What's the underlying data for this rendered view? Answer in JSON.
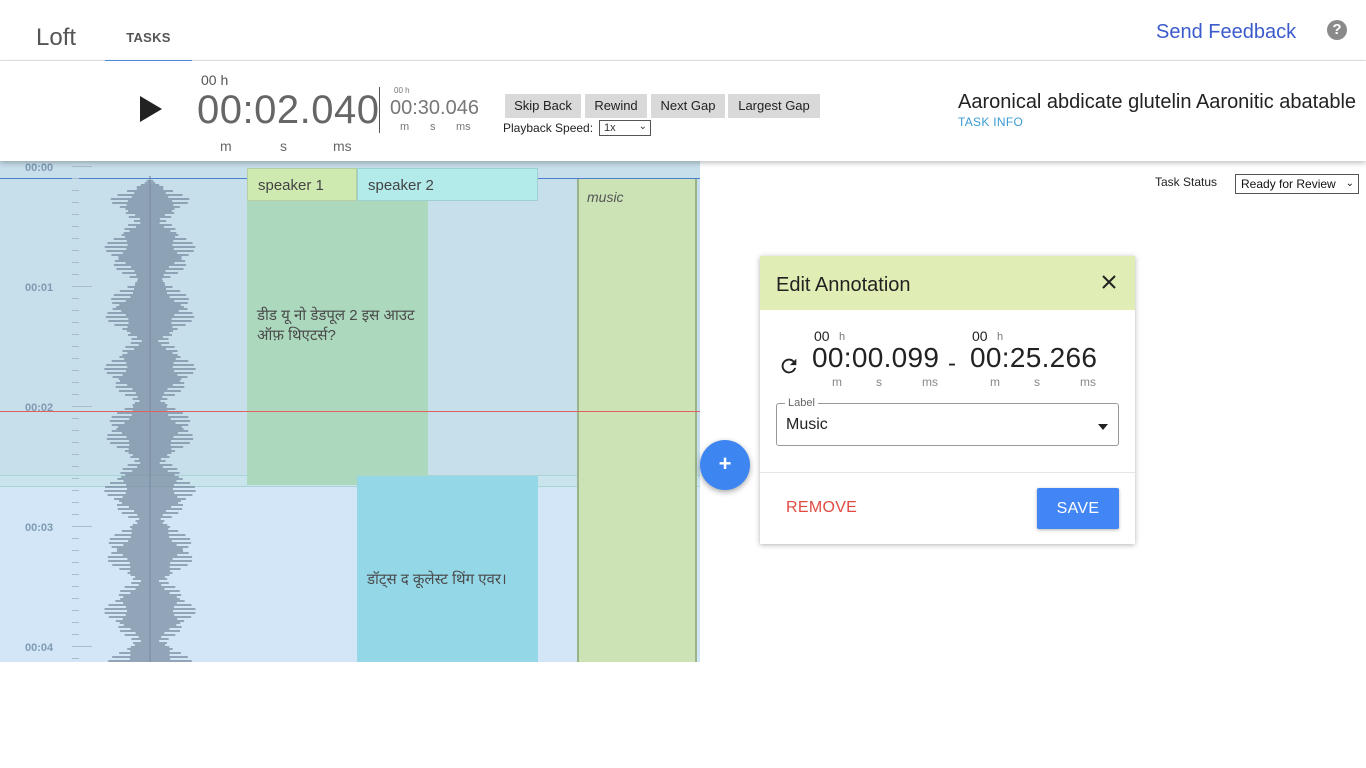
{
  "app": {
    "title": "Loft",
    "tab": "TASKS"
  },
  "header": {
    "feedback": "Send Feedback",
    "help_icon": "?"
  },
  "player": {
    "hours": "00 h",
    "current_time": "00:02.040",
    "units": {
      "m": "m",
      "s": "s",
      "ms": "ms"
    },
    "duration_hours": "00 h",
    "duration": "00:30.046",
    "buttons": {
      "skip_back": "Skip Back",
      "rewind": "Rewind",
      "next_gap": "Next Gap",
      "largest_gap": "Largest Gap"
    },
    "speed_label": "Playback Speed:",
    "speed_value": "1x",
    "task_name": "Aaronical abdicate glutelin Aaronitic abatable",
    "task_info": "TASK INFO"
  },
  "task_status": {
    "label": "Task Status",
    "value": "Ready for Review"
  },
  "timeline": {
    "ticks": [
      "00:00",
      "00:01",
      "00:02",
      "00:03",
      "00:04"
    ],
    "speakers": [
      "speaker 1",
      "speaker 2"
    ],
    "music_label": "music",
    "segments": [
      {
        "speaker": "speaker 1",
        "text": "डीड यू नो डेडपूल 2 इस आउट ऑफ़ थिएटर्स?"
      },
      {
        "speaker": "speaker 2",
        "text": "डॉट्स द कूलेस्ट थिंग एवर।"
      }
    ],
    "add_button": "+"
  },
  "edit_annotation": {
    "title": "Edit Annotation",
    "start_hours": "00",
    "start_time": "00:00.099",
    "end_hours": "00",
    "end_time": "00:25.266",
    "separator": "-",
    "hour_unit": "h",
    "units": {
      "m": "m",
      "s": "s",
      "ms": "ms"
    },
    "label_legend": "Label",
    "label_value": "Music",
    "remove": "REMOVE",
    "save": "SAVE"
  },
  "colors": {
    "accent_blue": "#4285f4",
    "remove_red": "#e04a43",
    "panel_header": "#e0edb5",
    "speaker1": "#acd9bd",
    "speaker2": "#94d8e8",
    "music": "#cce3b6",
    "timeline_bg": "#d3e6f7"
  }
}
